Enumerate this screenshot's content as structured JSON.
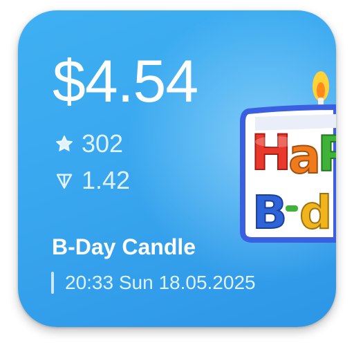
{
  "widget": {
    "price": "$4.54",
    "stars": {
      "icon": "star-icon",
      "value": "302"
    },
    "ton": {
      "icon": "ton-icon",
      "value": "1.42"
    },
    "gift_name": "B-Day Candle",
    "datetime": "20:33 Sun 18.05.2025",
    "sticker": {
      "icon": "birthday-candle-sticker",
      "line1": "HAPPY",
      "line2": "B-DAY"
    },
    "colors": {
      "background_top": "#3fb0f2",
      "background_bottom": "#2d96e6",
      "text": "#ffffff"
    }
  }
}
